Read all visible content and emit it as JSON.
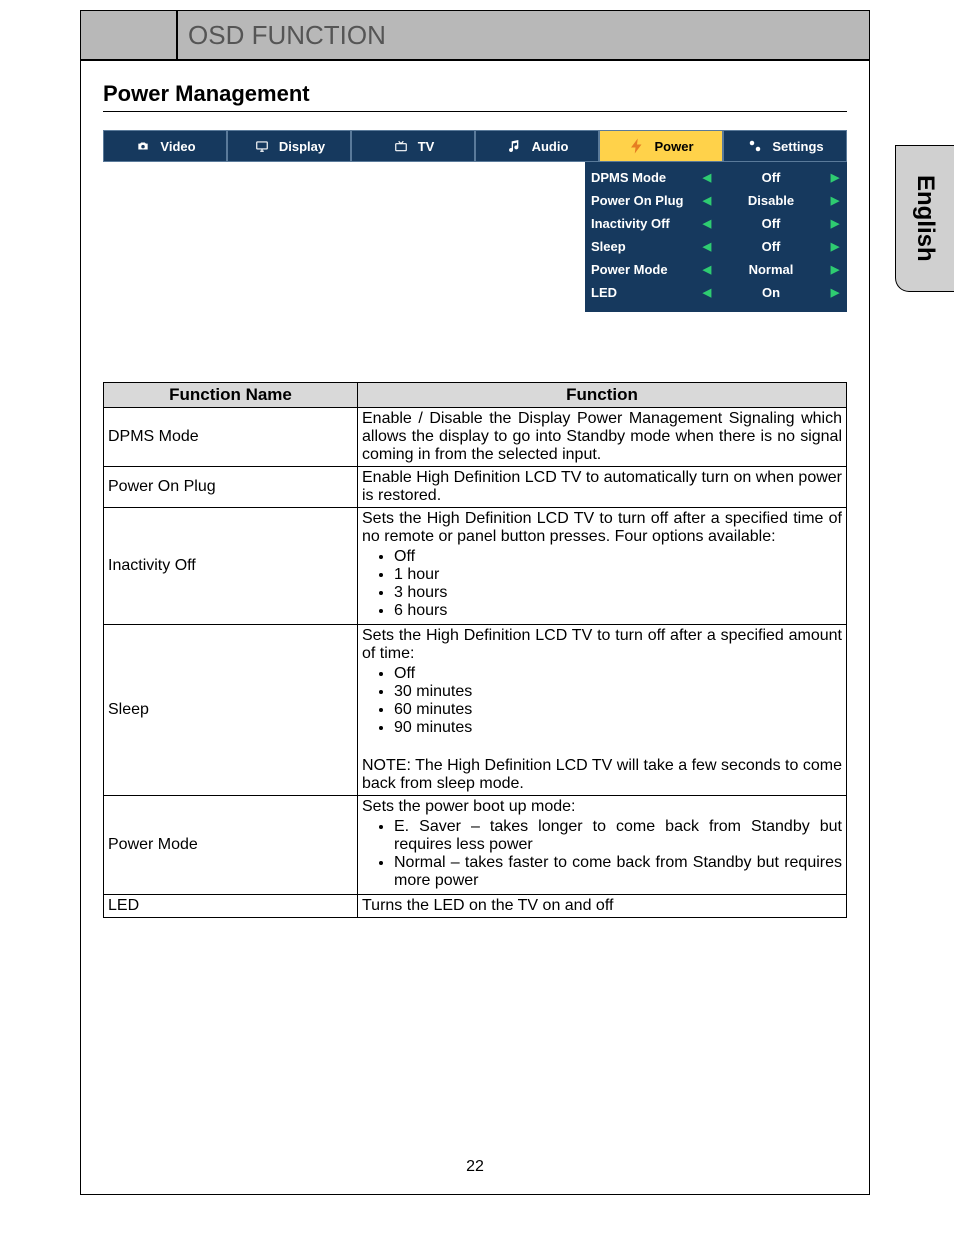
{
  "header": {
    "title": "OSD FUNCTION"
  },
  "section": {
    "title": "Power Management"
  },
  "side_tab": "English",
  "page_number": "22",
  "osd": {
    "tabs": [
      {
        "label": "Video",
        "icon": "camera-icon",
        "active": false
      },
      {
        "label": "Display",
        "icon": "monitor-icon",
        "active": false
      },
      {
        "label": "TV",
        "icon": "tv-icon",
        "active": false
      },
      {
        "label": "Audio",
        "icon": "music-icon",
        "active": false
      },
      {
        "label": "Power",
        "icon": "power-icon",
        "active": true
      },
      {
        "label": "Settings",
        "icon": "gears-icon",
        "active": false
      }
    ],
    "rows": [
      {
        "label": "DPMS Mode",
        "value": "Off"
      },
      {
        "label": "Power On Plug",
        "value": "Disable"
      },
      {
        "label": "Inactivity Off",
        "value": "Off"
      },
      {
        "label": "Sleep",
        "value": "Off"
      },
      {
        "label": "Power Mode",
        "value": "Normal"
      },
      {
        "label": "LED",
        "value": "On"
      }
    ]
  },
  "table": {
    "headers": {
      "name": "Function Name",
      "func": "Function"
    },
    "rows": [
      {
        "name": "DPMS Mode",
        "desc": "Enable / Disable the Display Power Management Signaling which allows the display to go into Standby mode when there is no signal coming in from the selected input."
      },
      {
        "name": "Power On Plug",
        "desc": "Enable High Definition LCD TV to automatically turn on when power is restored."
      },
      {
        "name": "Inactivity Off",
        "desc_intro": "Sets the High Definition LCD TV to turn off after a specified time of no remote or panel button presses. Four options available:",
        "bullets": [
          "Off",
          "1 hour",
          "3 hours",
          "6 hours"
        ]
      },
      {
        "name": "Sleep",
        "desc_intro": "Sets the High Definition LCD TV to turn off after a specified amount of time:",
        "bullets": [
          "Off",
          "30 minutes",
          "60 minutes",
          "90 minutes"
        ],
        "desc_outro": "NOTE: The High Definition LCD TV will take a few seconds to come back from sleep mode."
      },
      {
        "name": "Power Mode",
        "desc_intro": "Sets the power boot up mode:",
        "bullets": [
          "E. Saver – takes longer to come back from Standby but requires less power",
          "Normal – takes faster to come back from Standby but requires more power"
        ]
      },
      {
        "name": "LED",
        "desc": "Turns the LED on the TV on and off"
      }
    ]
  }
}
